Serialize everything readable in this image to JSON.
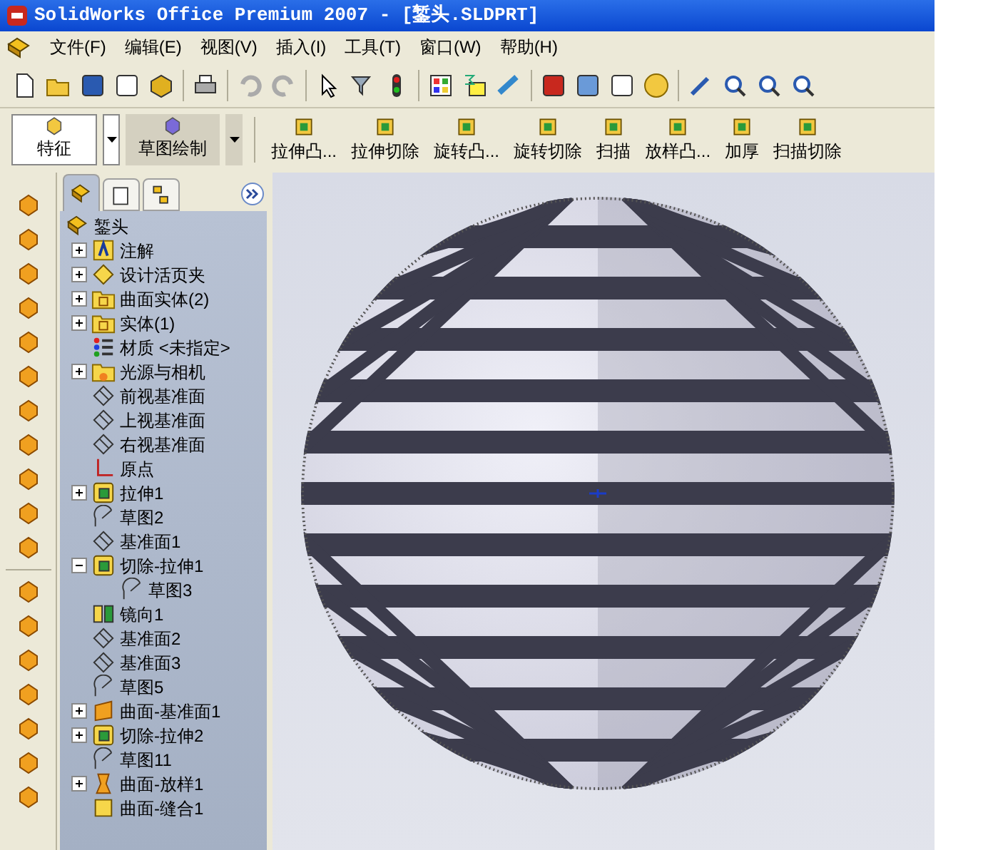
{
  "window": {
    "title": "SolidWorks Office Premium 2007 - [錾头.SLDPRT]"
  },
  "menu": [
    "文件(F)",
    "编辑(E)",
    "视图(V)",
    "插入(I)",
    "工具(T)",
    "窗口(W)",
    "帮助(H)"
  ],
  "feature_toolbar": {
    "tabs": [
      {
        "label": "特征",
        "selected": true
      },
      {
        "label": "草图绘制",
        "selected": false
      }
    ],
    "commands": [
      "拉伸凸...",
      "拉伸切除",
      "旋转凸...",
      "旋转切除",
      "扫描",
      "放样凸...",
      "加厚",
      "扫描切除"
    ]
  },
  "tree_tabs": [
    {
      "selected": true
    },
    {
      "selected": false
    },
    {
      "selected": false
    }
  ],
  "tree": {
    "label": "錾头",
    "kind": "part",
    "children": [
      {
        "label": "注解",
        "kind": "annotation",
        "expanded": false
      },
      {
        "label": "设计活页夹",
        "kind": "binder",
        "expanded": false
      },
      {
        "label": "曲面实体(2)",
        "kind": "folder",
        "expanded": false
      },
      {
        "label": "实体(1)",
        "kind": "folder",
        "expanded": false
      },
      {
        "label": "材质 <未指定>",
        "kind": "material"
      },
      {
        "label": "光源与相机",
        "kind": "lights",
        "expanded": false
      },
      {
        "label": "前视基准面",
        "kind": "plane"
      },
      {
        "label": "上视基准面",
        "kind": "plane"
      },
      {
        "label": "右视基准面",
        "kind": "plane"
      },
      {
        "label": "原点",
        "kind": "origin"
      },
      {
        "label": "拉伸1",
        "kind": "feature",
        "expanded": false
      },
      {
        "label": "草图2",
        "kind": "sketch"
      },
      {
        "label": "基准面1",
        "kind": "plane"
      },
      {
        "label": "切除-拉伸1",
        "kind": "feature",
        "expanded": true,
        "children": [
          {
            "label": "草图3",
            "kind": "sketch"
          }
        ]
      },
      {
        "label": "镜向1",
        "kind": "mirror"
      },
      {
        "label": "基准面2",
        "kind": "plane"
      },
      {
        "label": "基准面3",
        "kind": "plane"
      },
      {
        "label": "草图5",
        "kind": "sketch"
      },
      {
        "label": "曲面-基准面1",
        "kind": "surface",
        "expanded": false
      },
      {
        "label": "切除-拉伸2",
        "kind": "feature",
        "expanded": false
      },
      {
        "label": "草图11",
        "kind": "sketch"
      },
      {
        "label": "曲面-放样1",
        "kind": "loft",
        "expanded": false
      },
      {
        "label": "曲面-缝合1",
        "kind": "knit"
      }
    ]
  }
}
